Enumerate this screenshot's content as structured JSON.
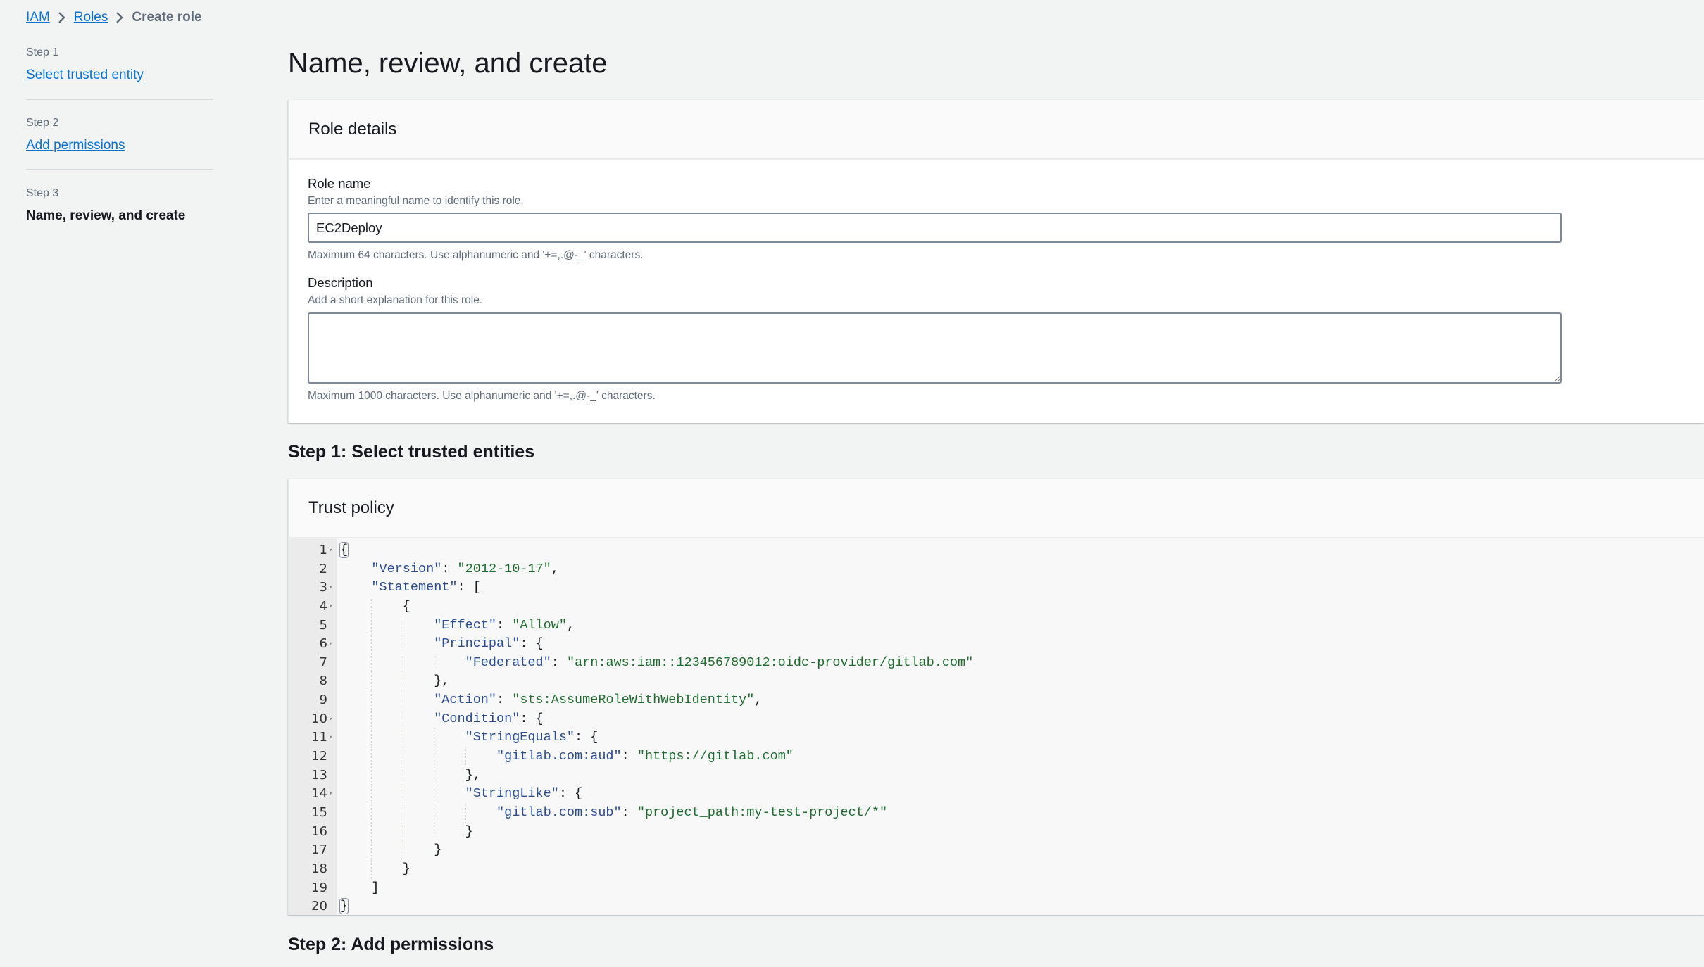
{
  "breadcrumb": {
    "items": [
      {
        "label": "IAM",
        "link": true
      },
      {
        "label": "Roles",
        "link": true
      },
      {
        "label": "Create role",
        "link": false
      }
    ]
  },
  "sidebar": {
    "steps": [
      {
        "step_label": "Step 1",
        "title": "Select trusted entity",
        "current": false
      },
      {
        "step_label": "Step 2",
        "title": "Add permissions",
        "current": false
      },
      {
        "step_label": "Step 3",
        "title": "Name, review, and create",
        "current": true
      }
    ]
  },
  "page": {
    "title": "Name, review, and create"
  },
  "role_details": {
    "header": "Role details",
    "role_name": {
      "label": "Role name",
      "description": "Enter a meaningful name to identify this role.",
      "value": "EC2Deploy",
      "constraint": "Maximum 64 characters. Use alphanumeric and '+=,.@-_' characters."
    },
    "description": {
      "label": "Description",
      "description": "Add a short explanation for this role.",
      "value": "",
      "constraint": "Maximum 1000 characters. Use alphanumeric and '+=,.@-_' characters."
    }
  },
  "step1": {
    "heading": "Step 1: Select trusted entities",
    "trust_policy": {
      "header": "Trust policy",
      "lines": [
        {
          "n": "1",
          "fold": true,
          "indent": 0,
          "tokens": [
            [
              "p",
              "{"
            ]
          ],
          "match": true
        },
        {
          "n": "2",
          "fold": false,
          "indent": 1,
          "tokens": [
            [
              "k",
              "\"Version\""
            ],
            [
              "p",
              ": "
            ],
            [
              "s",
              "\"2012-10-17\""
            ],
            [
              "p",
              ","
            ]
          ]
        },
        {
          "n": "3",
          "fold": true,
          "indent": 1,
          "tokens": [
            [
              "k",
              "\"Statement\""
            ],
            [
              "p",
              ": ["
            ]
          ]
        },
        {
          "n": "4",
          "fold": true,
          "indent": 2,
          "tokens": [
            [
              "p",
              "{"
            ]
          ]
        },
        {
          "n": "5",
          "fold": false,
          "indent": 3,
          "tokens": [
            [
              "k",
              "\"Effect\""
            ],
            [
              "p",
              ": "
            ],
            [
              "s",
              "\"Allow\""
            ],
            [
              "p",
              ","
            ]
          ]
        },
        {
          "n": "6",
          "fold": true,
          "indent": 3,
          "tokens": [
            [
              "k",
              "\"Principal\""
            ],
            [
              "p",
              ": {"
            ]
          ]
        },
        {
          "n": "7",
          "fold": false,
          "indent": 4,
          "tokens": [
            [
              "k",
              "\"Federated\""
            ],
            [
              "p",
              ": "
            ],
            [
              "s",
              "\"arn:aws:iam::123456789012:oidc-provider/gitlab.com\""
            ]
          ]
        },
        {
          "n": "8",
          "fold": false,
          "indent": 3,
          "tokens": [
            [
              "p",
              "},"
            ]
          ]
        },
        {
          "n": "9",
          "fold": false,
          "indent": 3,
          "tokens": [
            [
              "k",
              "\"Action\""
            ],
            [
              "p",
              ": "
            ],
            [
              "s",
              "\"sts:AssumeRoleWithWebIdentity\""
            ],
            [
              "p",
              ","
            ]
          ]
        },
        {
          "n": "10",
          "fold": true,
          "indent": 3,
          "tokens": [
            [
              "k",
              "\"Condition\""
            ],
            [
              "p",
              ": {"
            ]
          ]
        },
        {
          "n": "11",
          "fold": true,
          "indent": 4,
          "tokens": [
            [
              "k",
              "\"StringEquals\""
            ],
            [
              "p",
              ": {"
            ]
          ]
        },
        {
          "n": "12",
          "fold": false,
          "indent": 5,
          "tokens": [
            [
              "k",
              "\"gitlab.com:aud\""
            ],
            [
              "p",
              ": "
            ],
            [
              "s",
              "\"https://gitlab.com\""
            ]
          ]
        },
        {
          "n": "13",
          "fold": false,
          "indent": 4,
          "tokens": [
            [
              "p",
              "},"
            ]
          ]
        },
        {
          "n": "14",
          "fold": true,
          "indent": 4,
          "tokens": [
            [
              "k",
              "\"StringLike\""
            ],
            [
              "p",
              ": {"
            ]
          ]
        },
        {
          "n": "15",
          "fold": false,
          "indent": 5,
          "tokens": [
            [
              "k",
              "\"gitlab.com:sub\""
            ],
            [
              "p",
              ": "
            ],
            [
              "s",
              "\"project_path:my-test-project/*\""
            ]
          ]
        },
        {
          "n": "16",
          "fold": false,
          "indent": 4,
          "tokens": [
            [
              "p",
              "}"
            ]
          ]
        },
        {
          "n": "17",
          "fold": false,
          "indent": 3,
          "tokens": [
            [
              "p",
              "}"
            ]
          ]
        },
        {
          "n": "18",
          "fold": false,
          "indent": 2,
          "tokens": [
            [
              "p",
              "}"
            ]
          ]
        },
        {
          "n": "19",
          "fold": false,
          "indent": 1,
          "tokens": [
            [
              "p",
              "]"
            ]
          ]
        },
        {
          "n": "20",
          "fold": false,
          "indent": 0,
          "tokens": [
            [
              "p",
              "}"
            ]
          ],
          "match": true
        }
      ]
    }
  },
  "step2": {
    "heading": "Step 2: Add permissions"
  },
  "colors": {
    "link": "#0972d3",
    "json_key": "#2a4d8f",
    "json_string": "#1e6b2e",
    "page_bg": "#f2f3f3"
  }
}
